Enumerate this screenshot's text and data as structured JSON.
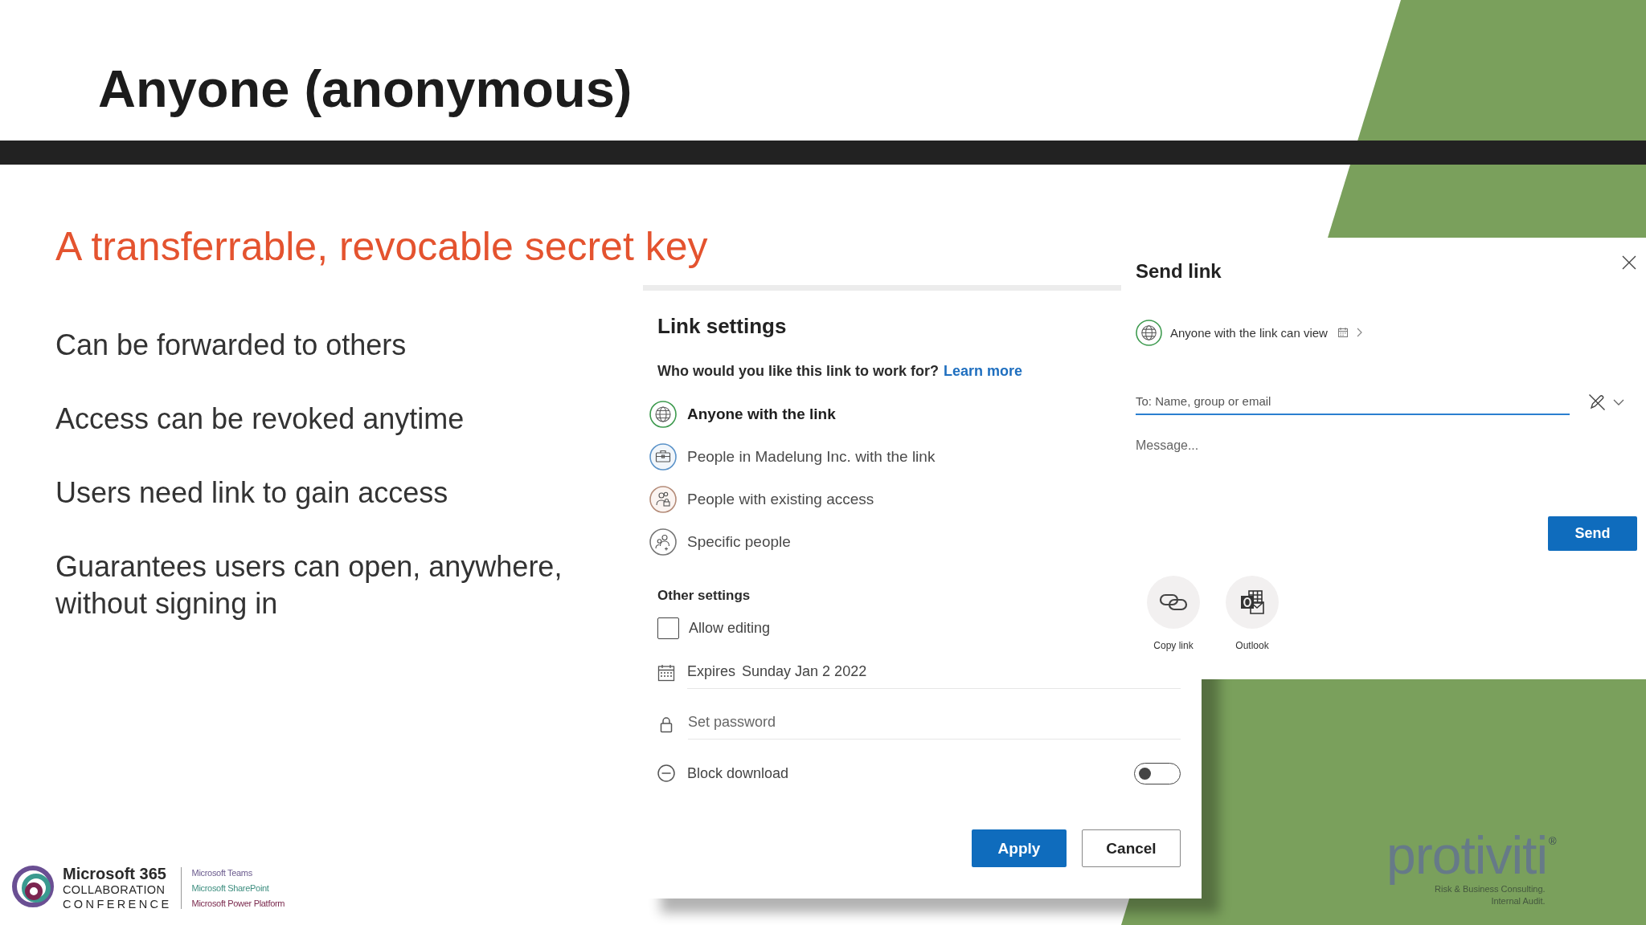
{
  "slide": {
    "title": "Anyone (anonymous)",
    "subtitle": "A transferrable, revocable secret key",
    "bullets": [
      "Can be forwarded to others",
      "Access can be revoked anytime",
      "Users need link to gain access",
      "Guarantees users can open, anywhere, without signing in"
    ]
  },
  "link_settings": {
    "title": "Link settings",
    "question": "Who would you like this link to work for?",
    "learn_more": "Learn more",
    "options": [
      {
        "kind": "anyone",
        "label": "Anyone with the link",
        "selected": true
      },
      {
        "kind": "organization",
        "label": "People in Madelung Inc. with the link",
        "selected": false
      },
      {
        "kind": "existing",
        "label": "People with existing access",
        "selected": false
      },
      {
        "kind": "specific",
        "label": "Specific people",
        "selected": false
      }
    ],
    "other_settings": {
      "heading": "Other settings",
      "allow_editing": {
        "label": "Allow editing",
        "checked": false
      },
      "expiry": {
        "label": "Expires",
        "value": "Sunday Jan 2 2022"
      },
      "password": {
        "placeholder": "Set password"
      },
      "block_download": {
        "label": "Block download",
        "on": false
      }
    },
    "buttons": [
      {
        "kind": "primary",
        "label": "Apply"
      },
      {
        "kind": "secondary",
        "label": "Cancel"
      }
    ]
  },
  "send_link": {
    "title": "Send link",
    "permission": "Anyone with the link can view",
    "to_field": {
      "placeholder": "To: Name, group or email"
    },
    "message_field": {
      "placeholder": "Message..."
    },
    "send_button": "Send",
    "share_targets": [
      {
        "kind": "copy_link",
        "label": "Copy link"
      },
      {
        "kind": "outlook",
        "label": "Outlook"
      }
    ]
  },
  "footer": {
    "conference_logo": {
      "lines": [
        "Microsoft 365",
        "COLLABORATION",
        "CONFERENCE"
      ],
      "products": [
        {
          "label": "Microsoft Teams",
          "color": "#6b5b8e"
        },
        {
          "label": "Microsoft SharePoint",
          "color": "#3f8f80"
        },
        {
          "label": "Microsoft Power Platform",
          "color": "#7b2a4e"
        }
      ]
    },
    "company_logo": {
      "name": "protiviti",
      "mark": "®",
      "tagline": [
        "Risk & Business Consulting.",
        "Internal Audit."
      ]
    }
  }
}
